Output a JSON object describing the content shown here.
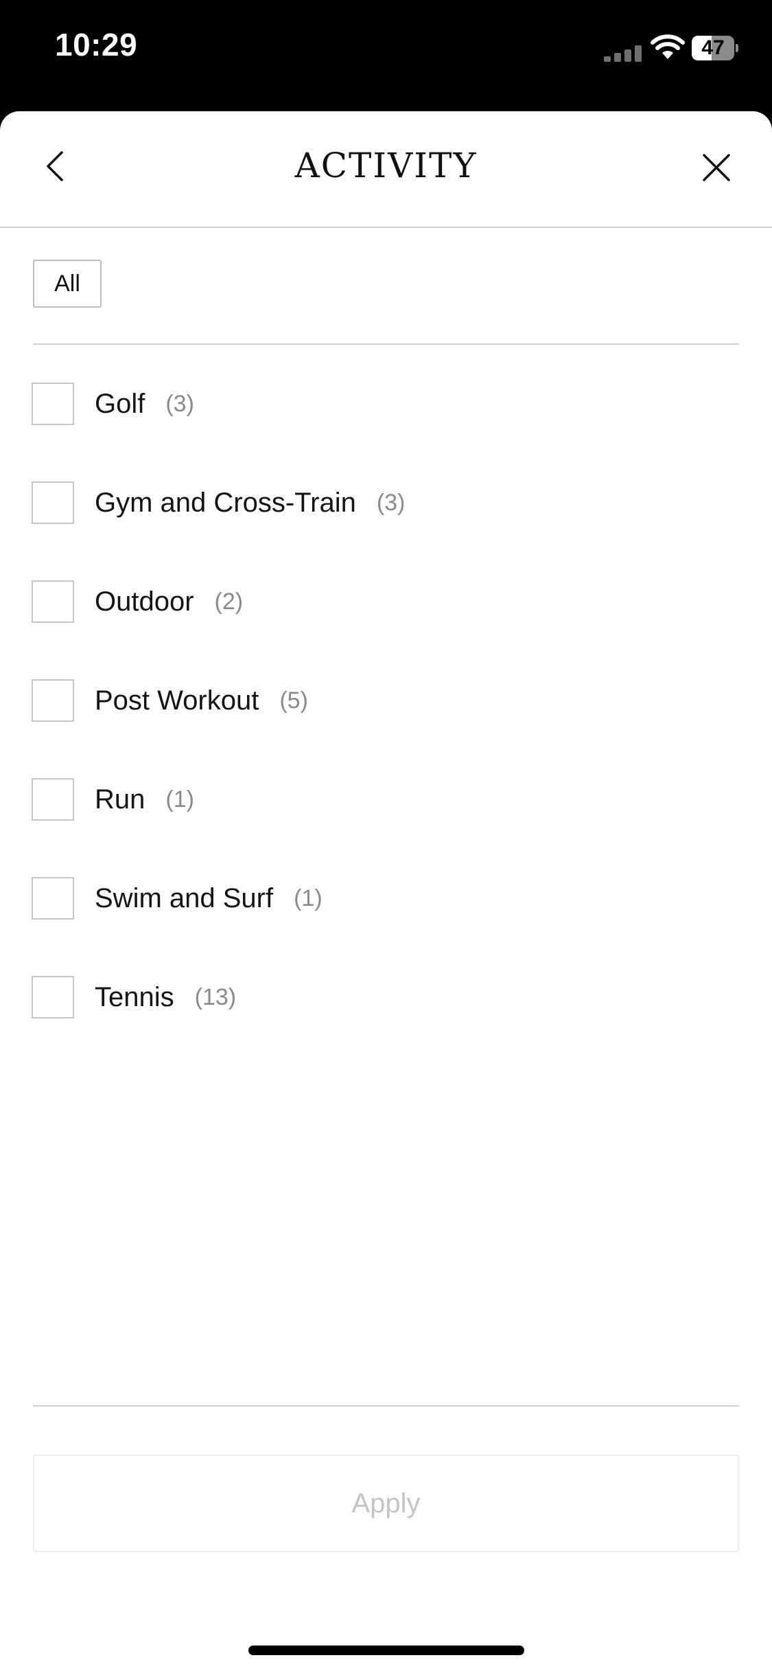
{
  "status_bar": {
    "time": "10:29",
    "battery": "47",
    "battery_level": 0.47,
    "icons": [
      "signal-icon",
      "wifi-icon",
      "battery-icon"
    ]
  },
  "header": {
    "title": "ACTIVITY",
    "back_icon": "chevron-left-icon",
    "close_icon": "close-icon"
  },
  "all_button": {
    "label": "All"
  },
  "items": [
    {
      "label": "Golf",
      "count": "(3)",
      "checked": false
    },
    {
      "label": "Gym and Cross-Train",
      "count": "(3)",
      "checked": false
    },
    {
      "label": "Outdoor",
      "count": "(2)",
      "checked": false
    },
    {
      "label": "Post Workout",
      "count": "(5)",
      "checked": false
    },
    {
      "label": "Run",
      "count": "(1)",
      "checked": false
    },
    {
      "label": "Swim and Surf",
      "count": "(1)",
      "checked": false
    },
    {
      "label": "Tennis",
      "count": "(13)",
      "checked": false
    }
  ],
  "apply_button": {
    "label": "Apply",
    "enabled": false
  },
  "colors": {
    "text": "#141414",
    "count": "#8a8a8a",
    "divider": "#d2d2d2",
    "disabled_text": "#c4c4c4"
  }
}
